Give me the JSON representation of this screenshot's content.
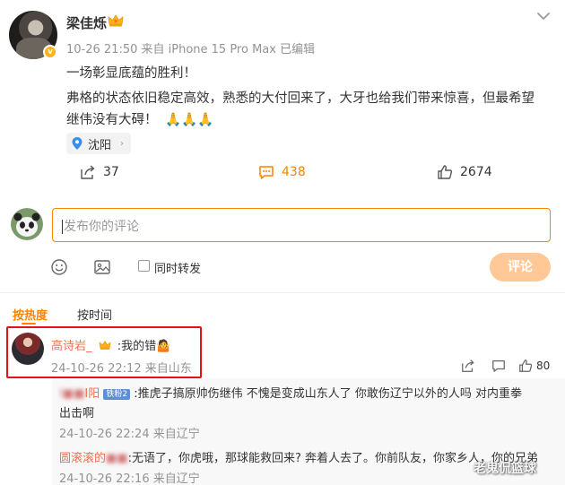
{
  "post": {
    "author": "梁佳烁",
    "meta": "10-26 21:50 来自 iPhone 15 Pro Max 已编辑",
    "line1": "一场彰显底蕴的胜利！",
    "line2": "弗格的状态依旧稳定高效，熟悉的大付回来了，大牙也给我们带来惊喜，但最希望",
    "line3": "继伟没有大碍！",
    "line3_emoji": "🙏🙏🙏",
    "location": "沈阳",
    "reposts": "37",
    "comments": "438",
    "likes": "2674"
  },
  "composer": {
    "placeholder": "发布你的评论",
    "repost_label": "同时转发",
    "submit_label": "评论"
  },
  "tabs": {
    "hot": "按热度",
    "time": "按时间"
  },
  "comment": {
    "author": "高诗岩_",
    "text": ":我的错🤷",
    "meta": "24-10-26 22:12 来自山东",
    "likes": "80"
  },
  "replies": [
    {
      "author": "I阳",
      "badge": "铁粉2",
      "text_a": ":推虎子搞原帅伤继伟  不愧是变成山东人了  你敢伤辽宁以外的人吗    对内重拳",
      "text_b": "出击啊",
      "meta": "24-10-26 22:24 来自辽宁"
    },
    {
      "author": "圆滚滚的",
      "text": ":无语了，你虎哦，那球能救回来? 奔着人去了。你前队友，你家乡人，你的兄弟",
      "meta": "24-10-26 22:16 来自辽宁"
    }
  ],
  "watermark": "老鬼侃篮球",
  "colors": {
    "accent": "#ff8200",
    "name_link": "#eb7350",
    "highlight": "#e01313",
    "muted": "#939393"
  }
}
